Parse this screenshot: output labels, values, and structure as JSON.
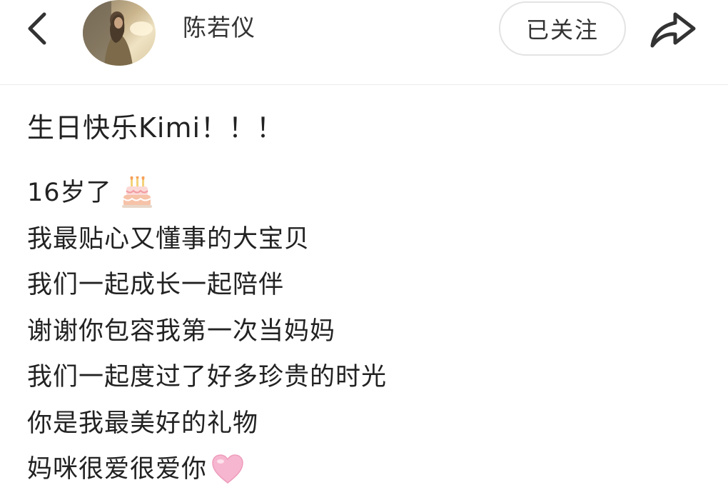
{
  "header": {
    "username": "陈若仪",
    "follow_label": "已关注"
  },
  "post": {
    "title": "生日快乐Kimi！！！",
    "lines": [
      {
        "text": "16岁了",
        "emoji": "birthday-cake"
      },
      {
        "text": "我最贴心又懂事的大宝贝"
      },
      {
        "text": "我们一起成长一起陪伴"
      },
      {
        "text": "谢谢你包容我第一次当妈妈"
      },
      {
        "text": "我们一起度过了好多珍贵的时光"
      },
      {
        "text": "你是我最美好的礼物"
      },
      {
        "text": "妈咪很爱很爱你",
        "emoji": "pink-heart"
      }
    ]
  },
  "icons": {
    "back": "chevron-left-icon",
    "share": "share-arrow-icon"
  }
}
